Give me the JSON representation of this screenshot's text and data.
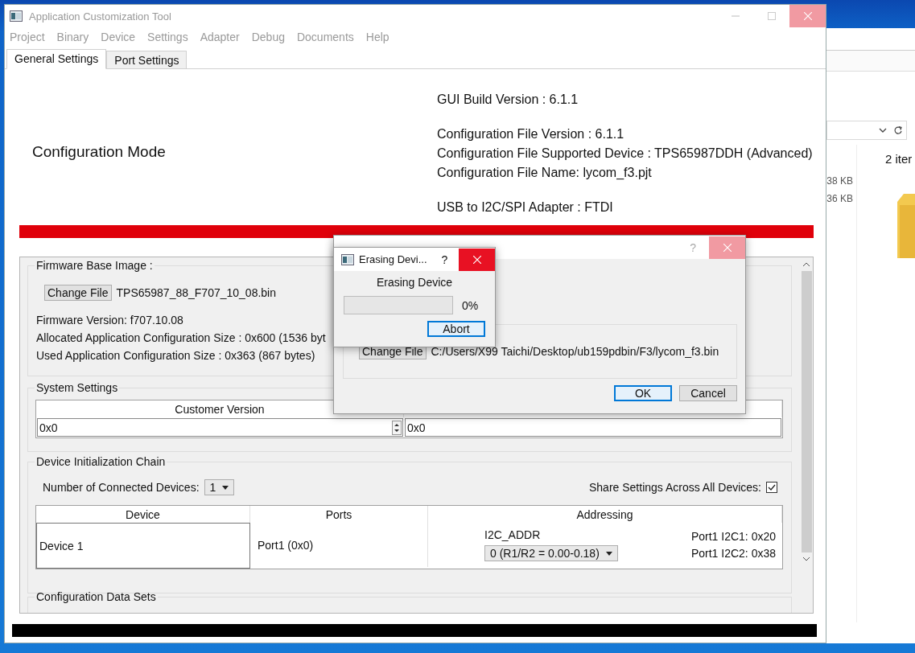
{
  "window": {
    "title": "Application Customization Tool"
  },
  "menu": [
    {
      "label": "Project",
      "disabled": true
    },
    {
      "label": "Binary",
      "disabled": true
    },
    {
      "label": "Device",
      "disabled": true
    },
    {
      "label": "Settings",
      "disabled": true
    },
    {
      "label": "Adapter",
      "disabled": true
    },
    {
      "label": "Debug",
      "disabled": true
    },
    {
      "label": "Documents",
      "disabled": true
    },
    {
      "label": "Help",
      "disabled": true
    }
  ],
  "tabs": [
    {
      "label": "General Settings",
      "selected": true
    },
    {
      "label": "Port Settings",
      "selected": false
    }
  ],
  "header": {
    "mode": "Configuration Mode",
    "info_groups": [
      [
        "GUI Build Version : 6.1.1"
      ],
      [
        "Configuration File Version : 6.1.1",
        "Configuration File Supported Device : TPS65987DDH (Advanced)",
        "Configuration File Name: lycom_f3.pjt"
      ],
      [
        "USB to I2C/SPI Adapter : FTDI"
      ]
    ]
  },
  "firmware": {
    "title": "Firmware Base Image :",
    "button": "Change File",
    "file": "TPS65987_88_F707_10_08.bin",
    "lines": [
      "Firmware Version:  f707.10.08",
      "Allocated Application Configuration Size :  0x600 (1536 byt",
      "Used Application Configuration Size :  0x363 (867 bytes)"
    ]
  },
  "system_settings": {
    "title": "System Settings",
    "columns": [
      "Customer Version"
    ],
    "values": [
      "0x0",
      "0x0"
    ]
  },
  "device_chain": {
    "title": "Device Initialization Chain",
    "count_label": "Number of Connected Devices:",
    "count": "1",
    "share_label": "Share Settings Across All Devices:",
    "share_checked": true,
    "columns": [
      "Device",
      "Ports",
      "Addressing"
    ],
    "rows": [
      {
        "device": "Device 1",
        "ports": "Port1 (0x0)",
        "addr_label": "I2C_ADDR",
        "addr_value": "0 (R1/R2 = 0.00-0.18)",
        "addresses": [
          "Port1 I2C1: 0x20",
          "Port1 I2C2: 0x38"
        ]
      }
    ]
  },
  "next_section": {
    "title": "Configuration Data Sets"
  },
  "flash_dialog": {
    "help": "?",
    "button": "Change File",
    "path": "C:/Users/X99 Taichi/Desktop/ub159pdbin/F3/lycom_f3.bin",
    "ok": "OK",
    "cancel": "Cancel"
  },
  "erasing_dialog": {
    "title": "Erasing Devi...",
    "help": "?",
    "message": "Erasing Device",
    "level": 0,
    "reading": "0%",
    "button": "Abort"
  },
  "explorer": {
    "item_count": "2 iter",
    "sizes": [
      "38 KB",
      "36 KB"
    ]
  }
}
